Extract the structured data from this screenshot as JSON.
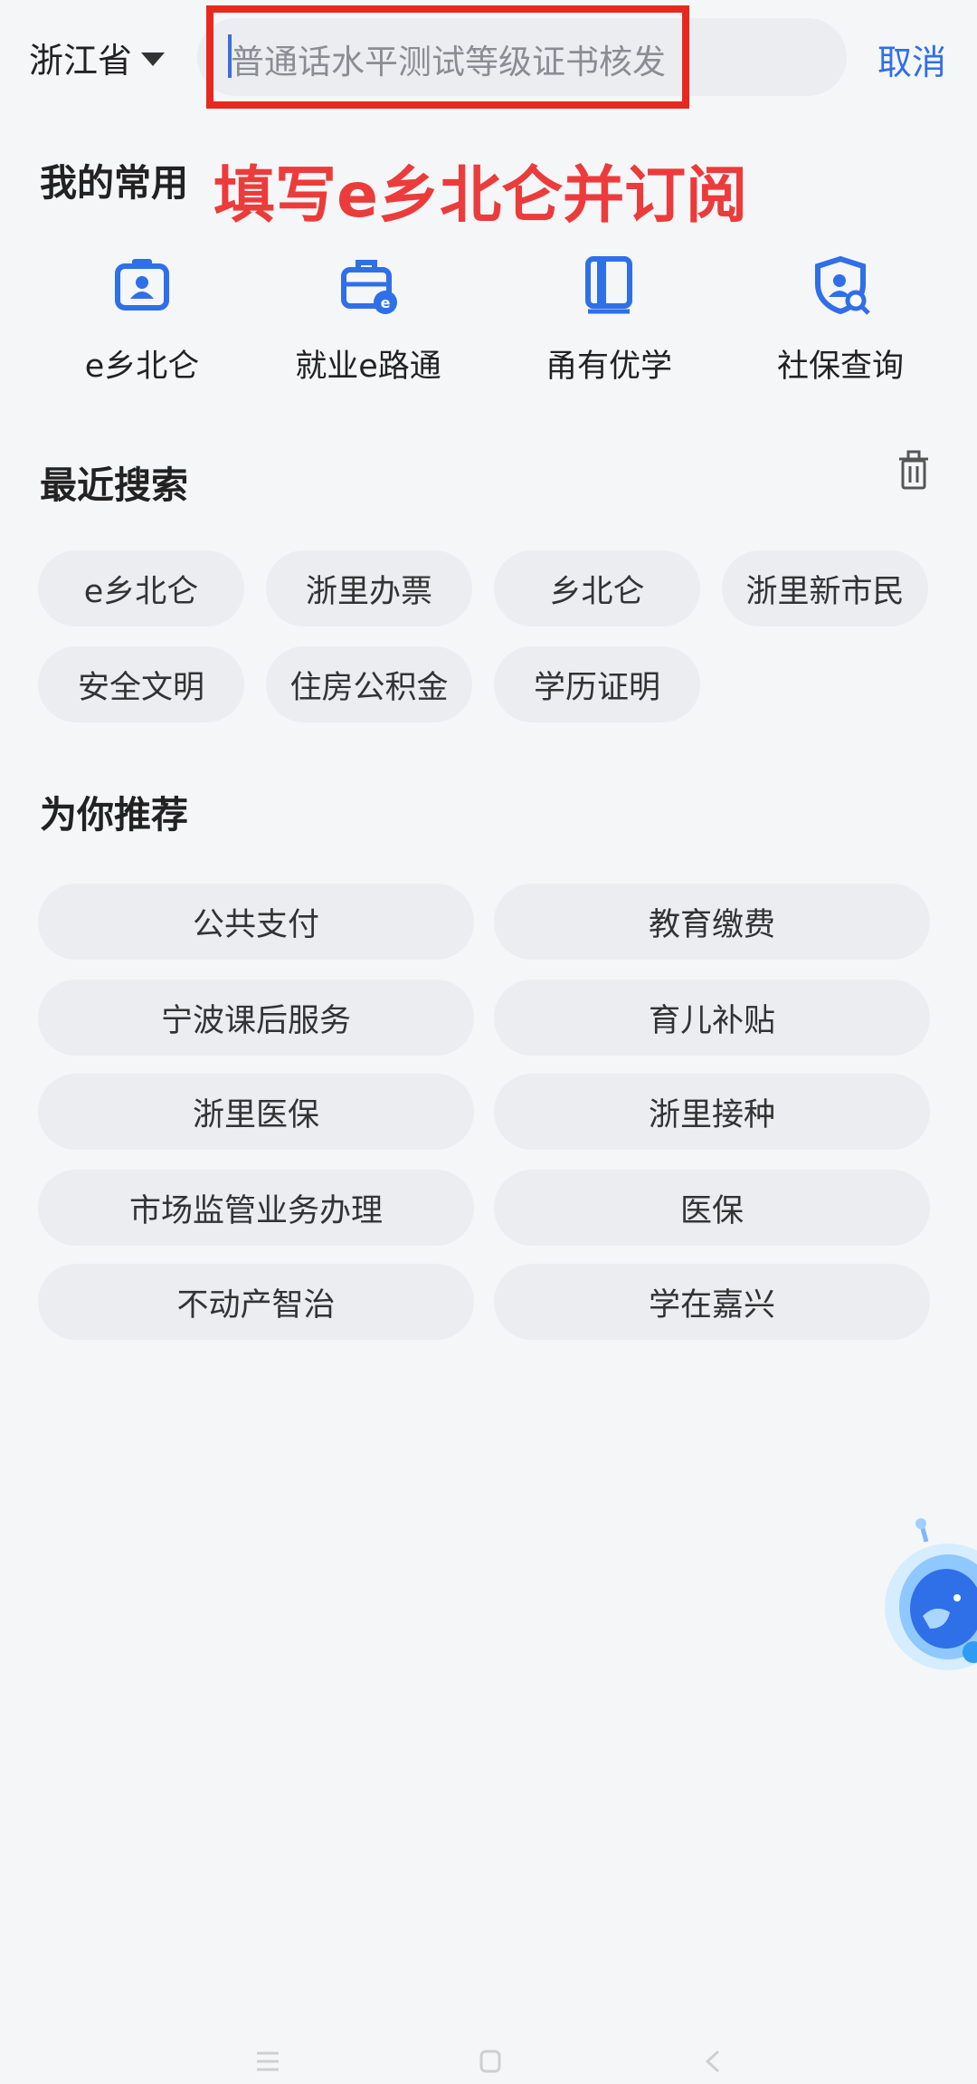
{
  "header": {
    "region": "浙江省",
    "search_placeholder": "普通话水平测试等级证书核发",
    "cancel_label": "取消"
  },
  "favorites": {
    "title": "我的常用",
    "annotation": "填写e乡北仑并订阅",
    "items": [
      {
        "label": "e乡北仑",
        "icon": "id-badge-icon"
      },
      {
        "label": "就业e路通",
        "icon": "briefcase-icon"
      },
      {
        "label": "甬有优学",
        "icon": "book-icon"
      },
      {
        "label": "社保查询",
        "icon": "shield-search-icon"
      }
    ]
  },
  "recent": {
    "title": "最近搜索",
    "clear_icon": "trash-icon",
    "items": [
      "e乡北仑",
      "浙里办票",
      "乡北仑",
      "浙里新市民",
      "安全文明",
      "住房公积金",
      "学历证明"
    ]
  },
  "recommend": {
    "title": "为你推荐",
    "items": [
      "公共支付",
      "教育缴费",
      "宁波课后服务",
      "育儿补贴",
      "浙里医保",
      "浙里接种",
      "市场监管业务办理",
      "医保",
      "不动产智治",
      "学在嘉兴"
    ]
  },
  "colors": {
    "accent": "#2f6fe8",
    "annotation": "#ec3b3b",
    "highlight_border": "#e8281f",
    "chip_bg": "#ebedf1",
    "page_bg": "#f5f6f8"
  },
  "floating": {
    "icon": "assistant-robot-icon"
  },
  "navbar": {
    "icons": [
      "menu-icon",
      "home-icon",
      "back-icon"
    ]
  }
}
